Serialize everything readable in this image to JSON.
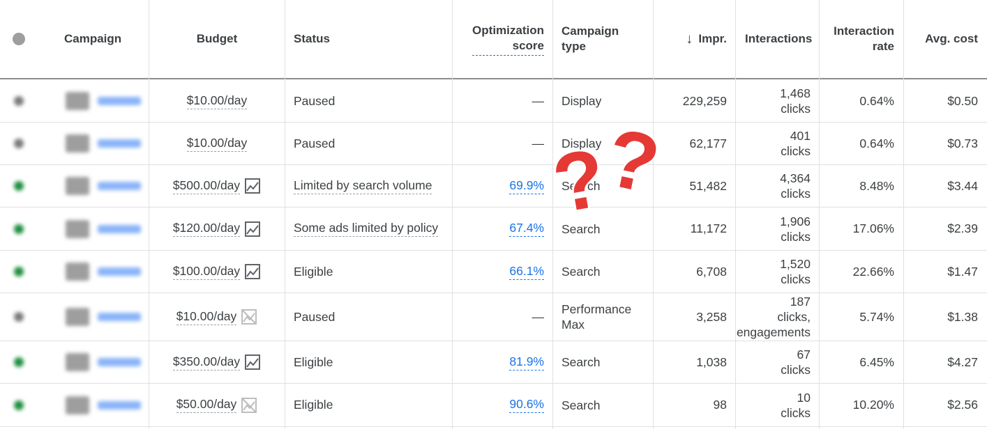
{
  "header": {
    "status_col": "",
    "campaign": "Campaign",
    "budget": "Budget",
    "status": "Status",
    "optimization_line1": "Optimization",
    "optimization_line2": "score",
    "campaign_type_line1": "Campaign",
    "campaign_type_line2": "type",
    "sort_arrow": "↓",
    "impr": "Impr.",
    "interactions": "Interactions",
    "interaction_rate_line1": "Interaction",
    "interaction_rate_line2": "rate",
    "avg_cost": "Avg. cost"
  },
  "rows": [
    {
      "dot": "grey",
      "budget": "$10.00/day",
      "budget_icon": "none",
      "status": "Paused",
      "status_dashed": false,
      "score": "—",
      "type_line1": "Display",
      "type_line2": "",
      "impr": "229,259",
      "inter_line1": "1,468",
      "inter_line2": "clicks",
      "inter_line3": "",
      "rate": "0.64%",
      "cost": "$0.50"
    },
    {
      "dot": "grey",
      "budget": "$10.00/day",
      "budget_icon": "none",
      "status": "Paused",
      "status_dashed": false,
      "score": "—",
      "type_line1": "Display",
      "type_line2": "",
      "impr": "62,177",
      "inter_line1": "401",
      "inter_line2": "clicks",
      "inter_line3": "",
      "rate": "0.64%",
      "cost": "$0.73"
    },
    {
      "dot": "green",
      "budget": "$500.00/day",
      "budget_icon": "chart",
      "status": "Limited by search volume",
      "status_dashed": true,
      "score": "69.9%",
      "type_line1": "Search",
      "type_line2": "",
      "impr": "51,482",
      "inter_line1": "4,364",
      "inter_line2": "clicks",
      "inter_line3": "",
      "rate": "8.48%",
      "cost": "$3.44"
    },
    {
      "dot": "green",
      "budget": "$120.00/day",
      "budget_icon": "chart",
      "status": "Some ads limited by policy",
      "status_dashed": true,
      "score": "67.4%",
      "type_line1": "Search",
      "type_line2": "",
      "impr": "11,172",
      "inter_line1": "1,906",
      "inter_line2": "clicks",
      "inter_line3": "",
      "rate": "17.06%",
      "cost": "$2.39"
    },
    {
      "dot": "green",
      "budget": "$100.00/day",
      "budget_icon": "chart",
      "status": "Eligible",
      "status_dashed": false,
      "score": "66.1%",
      "type_line1": "Search",
      "type_line2": "",
      "impr": "6,708",
      "inter_line1": "1,520",
      "inter_line2": "clicks",
      "inter_line3": "",
      "rate": "22.66%",
      "cost": "$1.47"
    },
    {
      "dot": "grey",
      "budget": "$10.00/day",
      "budget_icon": "chart-off",
      "status": "Paused",
      "status_dashed": false,
      "score": "—",
      "type_line1": "Performance",
      "type_line2": "Max",
      "impr": "3,258",
      "inter_line1": "187",
      "inter_line2": "clicks,",
      "inter_line3": "engagements",
      "rate": "5.74%",
      "cost": "$1.38"
    },
    {
      "dot": "green",
      "budget": "$350.00/day",
      "budget_icon": "chart",
      "status": "Eligible",
      "status_dashed": false,
      "score": "81.9%",
      "type_line1": "Search",
      "type_line2": "",
      "impr": "1,038",
      "inter_line1": "67",
      "inter_line2": "clicks",
      "inter_line3": "",
      "rate": "6.45%",
      "cost": "$4.27"
    },
    {
      "dot": "green",
      "budget": "$50.00/day",
      "budget_icon": "chart-off",
      "status": "Eligible",
      "status_dashed": false,
      "score": "90.6%",
      "type_line1": "Search",
      "type_line2": "",
      "impr": "98",
      "inter_line1": "10",
      "inter_line2": "clicks",
      "inter_line3": "",
      "rate": "10.20%",
      "cost": "$2.56"
    }
  ],
  "overlay": {
    "symbol_1": "?",
    "symbol_2": "?",
    "color": "#e53935"
  },
  "colors": {
    "link": "#1a73e8",
    "enabled": "#1e8e3e",
    "paused": "#7a7a7a"
  }
}
